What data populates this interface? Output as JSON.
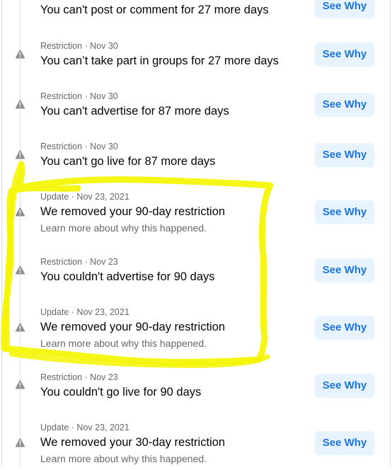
{
  "entries": [
    {
      "meta": "",
      "title": "You can't post or comment for 27 more days",
      "sub": "",
      "button": "See Why",
      "icon": "warning-icon"
    },
    {
      "meta": "Restriction · Nov 30",
      "title": "You can’t take part in groups for 27 more days",
      "sub": "",
      "button": "See Why",
      "icon": "warning-icon"
    },
    {
      "meta": "Restriction · Nov 30",
      "title": "You can't advertise for 87 more days",
      "sub": "",
      "button": "See Why",
      "icon": "warning-icon"
    },
    {
      "meta": "Restriction · Nov 30",
      "title": "You can't go live for 87 more days",
      "sub": "",
      "button": "See Why",
      "icon": "warning-icon"
    },
    {
      "meta": "Update · Nov 23, 2021",
      "title": "We removed your 90-day restriction",
      "sub": "Learn more about why this happened.",
      "button": "See Why",
      "icon": "warning-icon"
    },
    {
      "meta": "Restriction · Nov 23",
      "title": "You couldn't advertise for 90 days",
      "sub": "",
      "button": "See Why",
      "icon": "warning-icon"
    },
    {
      "meta": "Update · Nov 23, 2021",
      "title": "We removed your 90-day restriction",
      "sub": "Learn more about why this happened.",
      "button": "See Why",
      "icon": "warning-icon"
    },
    {
      "meta": "Restriction · Nov 23",
      "title": "You couldn't go live for 90 days",
      "sub": "",
      "button": "See Why",
      "icon": "warning-icon"
    },
    {
      "meta": "Update · Nov 23, 2021",
      "title": "We removed your 30-day restriction",
      "sub": "Learn more about why this happened.",
      "button": "See Why",
      "icon": "warning-icon"
    }
  ],
  "colors": {
    "highlight": "#f5f500",
    "button_bg": "#e7f3ff",
    "button_text": "#1b74e4",
    "meta_text": "#65676b",
    "title_text": "#050505"
  }
}
